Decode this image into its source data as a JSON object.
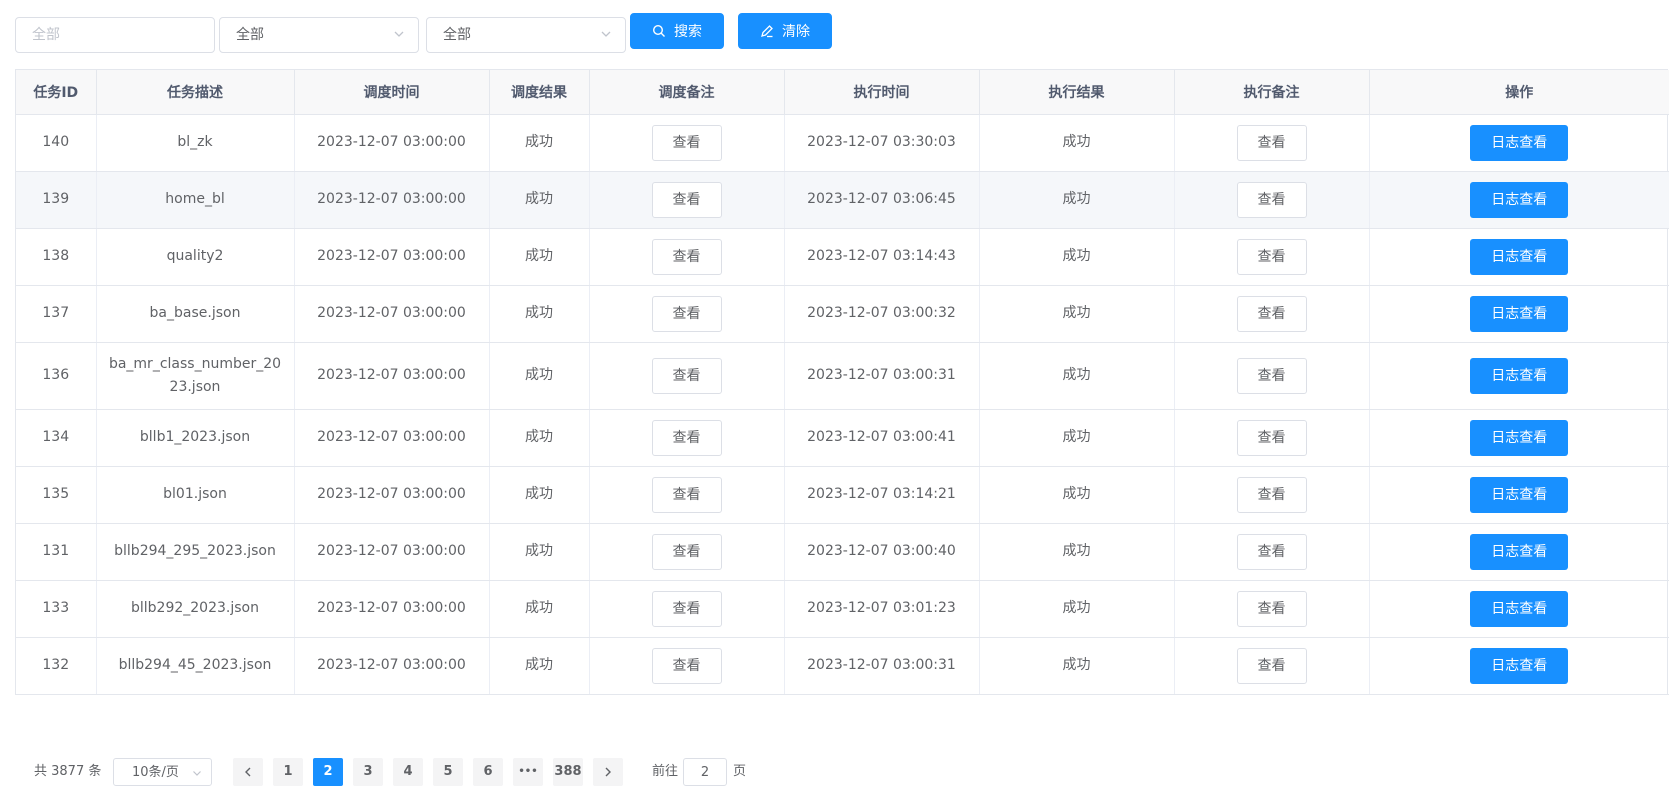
{
  "filters": {
    "task_input_placeholder": "全部",
    "select_1_value": "全部",
    "select_2_value": "全部",
    "search_label": "搜索",
    "clear_label": "清除"
  },
  "table": {
    "headers": [
      "任务ID",
      "任务描述",
      "调度时间",
      "调度结果",
      "调度备注",
      "执行时间",
      "执行结果",
      "执行备注",
      "操作"
    ],
    "view_label": "查看",
    "log_label": "日志查看",
    "rows": [
      {
        "id": "140",
        "desc": "bl_zk",
        "sched_time": "2023-12-07 03:00:00",
        "sched_result": "成功",
        "exec_time": "2023-12-07 03:30:03",
        "exec_result": "成功"
      },
      {
        "id": "139",
        "desc": "home_bl",
        "sched_time": "2023-12-07 03:00:00",
        "sched_result": "成功",
        "exec_time": "2023-12-07 03:06:45",
        "exec_result": "成功"
      },
      {
        "id": "138",
        "desc": "quality2",
        "sched_time": "2023-12-07 03:00:00",
        "sched_result": "成功",
        "exec_time": "2023-12-07 03:14:43",
        "exec_result": "成功"
      },
      {
        "id": "137",
        "desc": "ba_base.json",
        "sched_time": "2023-12-07 03:00:00",
        "sched_result": "成功",
        "exec_time": "2023-12-07 03:00:32",
        "exec_result": "成功"
      },
      {
        "id": "136",
        "desc": "ba_mr_class_number_2023.json",
        "sched_time": "2023-12-07 03:00:00",
        "sched_result": "成功",
        "exec_time": "2023-12-07 03:00:31",
        "exec_result": "成功"
      },
      {
        "id": "134",
        "desc": "bllb1_2023.json",
        "sched_time": "2023-12-07 03:00:00",
        "sched_result": "成功",
        "exec_time": "2023-12-07 03:00:41",
        "exec_result": "成功"
      },
      {
        "id": "135",
        "desc": "bl01.json",
        "sched_time": "2023-12-07 03:00:00",
        "sched_result": "成功",
        "exec_time": "2023-12-07 03:14:21",
        "exec_result": "成功"
      },
      {
        "id": "131",
        "desc": "bllb294_295_2023.json",
        "sched_time": "2023-12-07 03:00:00",
        "sched_result": "成功",
        "exec_time": "2023-12-07 03:00:40",
        "exec_result": "成功"
      },
      {
        "id": "133",
        "desc": "bllb292_2023.json",
        "sched_time": "2023-12-07 03:00:00",
        "sched_result": "成功",
        "exec_time": "2023-12-07 03:01:23",
        "exec_result": "成功"
      },
      {
        "id": "132",
        "desc": "bllb294_45_2023.json",
        "sched_time": "2023-12-07 03:00:00",
        "sched_result": "成功",
        "exec_time": "2023-12-07 03:00:31",
        "exec_result": "成功"
      }
    ]
  },
  "pagination": {
    "total_text": "共 3877 条",
    "page_size": "10条/页",
    "pages": [
      "1",
      "2",
      "3",
      "4",
      "5",
      "6"
    ],
    "ellipsis": "•••",
    "last_page": "388",
    "current_page": "2",
    "goto_prefix": "前往",
    "goto_value": "2",
    "goto_suffix": "页"
  },
  "colors": {
    "primary": "#1890ff",
    "border": "#e4e7ed",
    "header_bg": "#f8f8f9",
    "highlight_row_bg": "#f5f7fa"
  }
}
